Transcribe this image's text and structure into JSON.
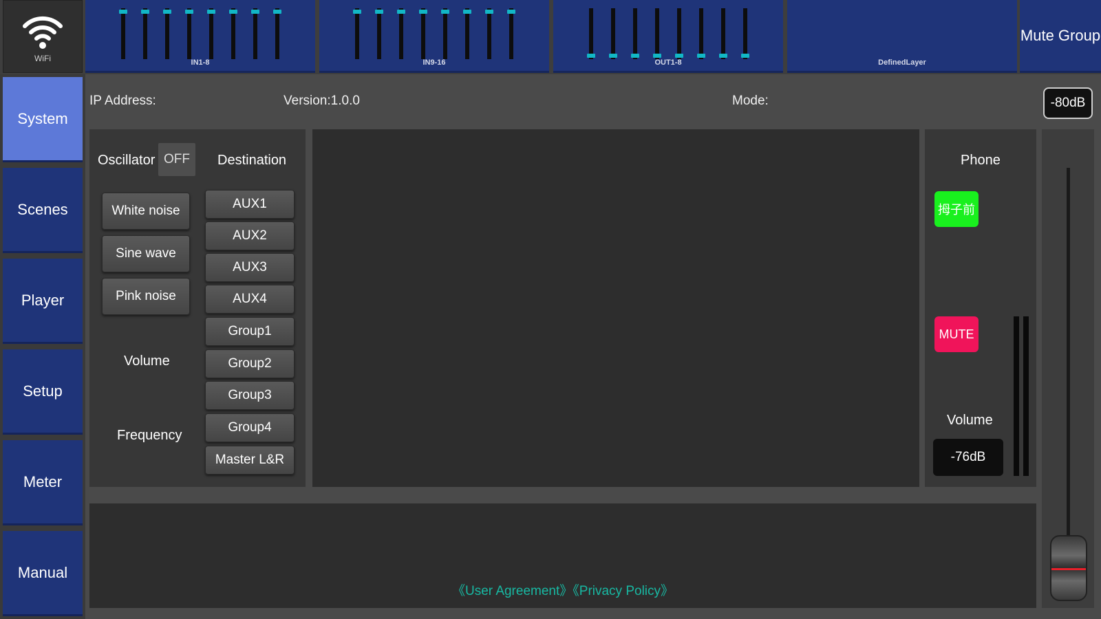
{
  "topbar": {
    "wifi_label": "WiFi",
    "layers": [
      {
        "label": "IN1-8",
        "faders": 8,
        "style": "top"
      },
      {
        "label": "IN9-16",
        "faders": 8,
        "style": "top"
      },
      {
        "label": "OUT1-8",
        "faders": 8,
        "style": "bottom"
      },
      {
        "label": "DefinedLayer",
        "faders": 0,
        "style": "none"
      }
    ],
    "mute_group": "Mute Group"
  },
  "sidebar": {
    "items": [
      {
        "label": "System",
        "active": true
      },
      {
        "label": "Scenes",
        "active": false
      },
      {
        "label": "Player",
        "active": false
      },
      {
        "label": "Setup",
        "active": false
      },
      {
        "label": "Meter",
        "active": false
      },
      {
        "label": "Manual",
        "active": false
      }
    ]
  },
  "info": {
    "ip_label": "IP Address:",
    "version": "Version:1.0.0",
    "mode_label": "Mode:",
    "master_db": "-80dB"
  },
  "oscillator": {
    "label": "Oscillator",
    "state": "OFF",
    "destination_label": "Destination",
    "types": [
      "White noise",
      "Sine wave",
      "Pink noise"
    ],
    "volume_label": "Volume",
    "frequency_label": "Frequency",
    "destinations": [
      "AUX1",
      "AUX2",
      "AUX3",
      "AUX4",
      "Group1",
      "Group2",
      "Group3",
      "Group4",
      "Master L&R"
    ]
  },
  "phone": {
    "title": "Phone",
    "green_button": "拇子前",
    "mute_button": "MUTE",
    "volume_label": "Volume",
    "volume_value": "-76dB"
  },
  "footer": {
    "user_agreement": "《User Agreement》",
    "privacy_policy": "《Privacy Policy》"
  },
  "colors": {
    "accent_blue": "#1f3479",
    "active_nav": "#5d79d8",
    "fader_cap": "#12b7c6",
    "green": "#19f01e",
    "mute": "#f0145a",
    "link": "#18b9a3"
  }
}
